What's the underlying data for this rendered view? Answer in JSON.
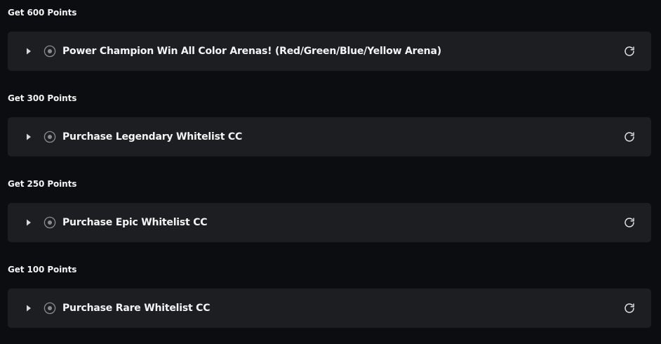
{
  "groups": [
    {
      "heading": "Get 600 Points",
      "task": {
        "title": "Power Champion Win All Color Arenas! (Red/Green/Blue/Yellow Arena)"
      }
    },
    {
      "heading": "Get 300 Points",
      "task": {
        "title": "Purchase Legendary Whitelist CC"
      }
    },
    {
      "heading": "Get 250 Points",
      "task": {
        "title": "Purchase Epic Whitelist CC"
      }
    },
    {
      "heading": "Get 100 Points",
      "task": {
        "title": "Purchase Rare Whitelist CC"
      }
    }
  ],
  "icons": {
    "expand": "caret-right-icon",
    "status": "radio-circle-icon",
    "refresh": "refresh-icon"
  },
  "colors": {
    "background": "#0c0d10",
    "card": "#1d1e22",
    "text": "#f4f4f4",
    "icon": "#d9d9d9",
    "status_ring": "#8a8b8f"
  }
}
